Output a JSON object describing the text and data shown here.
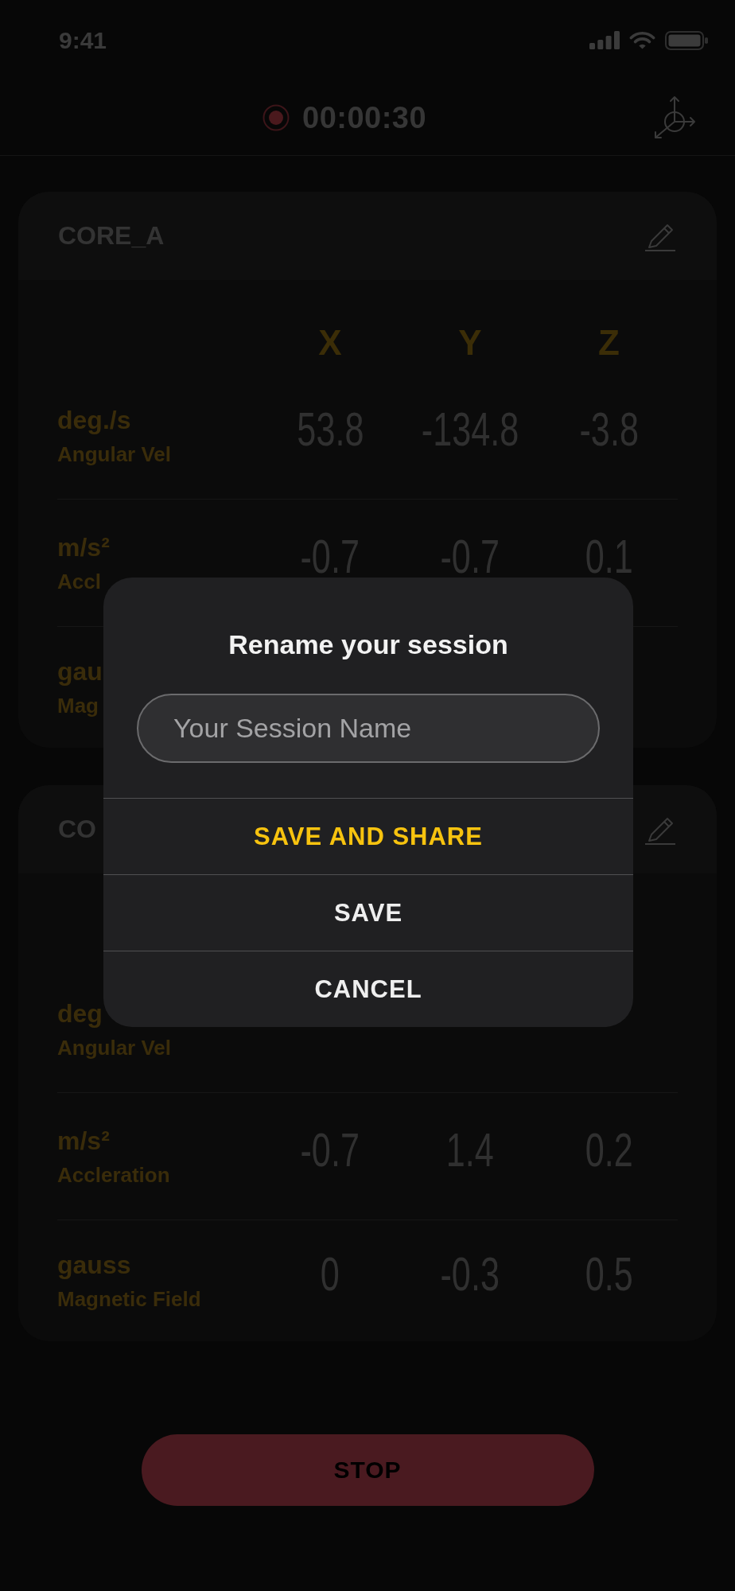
{
  "status_bar": {
    "time": "9:41"
  },
  "header": {
    "timer": "00:00:30"
  },
  "cards": [
    {
      "title": "CORE_A",
      "columns": [
        "X",
        "Y",
        "Z"
      ],
      "rows": [
        {
          "unit": "deg./s",
          "label": "Angular Vel",
          "values": [
            "53.8",
            "-134.8",
            "-3.8"
          ]
        },
        {
          "unit": "m/s²",
          "label": "Accl",
          "values": [
            "-0.7",
            "-0.7",
            "0.1"
          ]
        },
        {
          "unit": "gau",
          "label": "Mag"
        }
      ]
    },
    {
      "title": "CO",
      "rows": [
        {
          "unit": "deg",
          "label": "Angular Vel"
        },
        {
          "unit": "m/s²",
          "label": "Accleration",
          "values": [
            "-0.7",
            "1.4",
            "0.2"
          ]
        },
        {
          "unit": "gauss",
          "label": "Magnetic Field",
          "values": [
            "0",
            "-0.3",
            "0.5"
          ]
        }
      ]
    }
  ],
  "stop_button": {
    "label": "STOP"
  },
  "dialog": {
    "title": "Rename your session",
    "field": {
      "placeholder": "Your Session Name"
    },
    "buttons": [
      {
        "label": "SAVE AND SHARE",
        "kind": "primary"
      },
      {
        "label": "SAVE",
        "kind": "default"
      },
      {
        "label": "CANCEL",
        "kind": "default"
      }
    ]
  }
}
